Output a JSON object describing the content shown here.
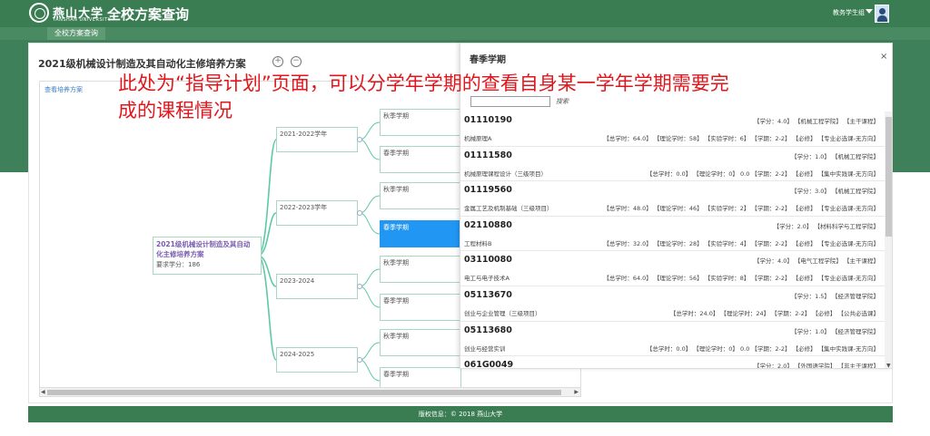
{
  "header": {
    "logo_text": "燕山大学",
    "logo_subtext": "YANSHAN UNIVERSITY",
    "app_title": "全校方案查询",
    "user_menu_label": "教务学生组"
  },
  "nav": {
    "tab_label": "全校方案查询"
  },
  "plan": {
    "title": "2021级机械设计制造及其自动化主修培养方案",
    "zoom_in_label": "+",
    "zoom_out_label": "−",
    "view_link": "查看培养方案",
    "root_title_line1": "2021级机械设计制造及其自动",
    "root_title_line2": "化主修培养方案",
    "root_credits": "要求学分：186",
    "years": [
      {
        "label": "2021-2022学年",
        "terms": [
          "秋季学期",
          "春季学期"
        ]
      },
      {
        "label": "2022-2023学年",
        "terms": [
          "秋季学期",
          "春季学期"
        ]
      },
      {
        "label": "2023-2024",
        "terms": [
          "秋季学期",
          "春季学期"
        ]
      },
      {
        "label": "2024-2025",
        "terms": [
          "秋季学期",
          "春季学期"
        ]
      }
    ]
  },
  "annotation": {
    "line1": "此处为“指导计划”页面，可以分学年学期的查看自身某一学年学期需要完",
    "line2": "成的课程情况"
  },
  "term_panel": {
    "title": "春季学期",
    "close_label": "×",
    "search_label": "搜索",
    "courses": [
      {
        "code": "01110190",
        "tags": "【学分：4.0】 【机械工程学院】 【主干课程】",
        "name": "机械原理A",
        "detail": "【总学时：64.0】 【理论学时：58】 【实验学时：6】 【学期：2-2】 【必修】 【专业必选课-无方向】"
      },
      {
        "code": "01111580",
        "tags": "【学分：1.0】 【机械工程学院】",
        "name": "机械原理课程设计（三级项目）",
        "detail": "【总学时：0.0】 【理论学时：0】 0.0 【学期：2-2】 【必修】 【集中实践课-无方向】"
      },
      {
        "code": "01119560",
        "tags": "【学分：3.0】 【机械工程学院】",
        "name": "金属工艺及机制基础（三级项目）",
        "detail": "【总学时：48.0】 【理论学时：46】 【实验学时：2】 【学期：2-2】 【必修】 【专业必选课-无方向】"
      },
      {
        "code": "02110880",
        "tags": "【学分：2.0】 【材料科学与工程学院】",
        "name": "工程材料B",
        "detail": "【总学时：32.0】 【理论学时：28】 【实验学时：4】 【学期：2-2】 【必修】 【专业必选课-无方向】"
      },
      {
        "code": "03110080",
        "tags": "【学分：4.0】 【电气工程学院】 【主干课程】",
        "name": "电工与电子技术A",
        "detail": "【总学时：64.0】 【理论学时：56】 【实验学时：8】 【学期：2-2】 【必修】 【专业必选课-无方向】"
      },
      {
        "code": "05113670",
        "tags": "【学分：1.5】 【经济管理学院】",
        "name": "创业与企业管理（三级项目）",
        "detail": "【总学时：24.0】 【理论学时：24】 【学期：2-2】 【必修】 【公共必选课】"
      },
      {
        "code": "05113680",
        "tags": "【学分：1.0】 【经济管理学院】",
        "name": "创业与经营实训",
        "detail": "【总学时：0.0】 【理论学时：0】 0.0 【学期：2-2】 【必修】 【集中实践课-无方向】"
      },
      {
        "code": "061G0049",
        "tags": "【学分：2.0】 【外国语学院】 【非主干课程】",
        "name": "",
        "detail": ""
      }
    ]
  },
  "footer": {
    "copyright": "版权信息：© 2018 燕山大学"
  },
  "colors": {
    "brand_green": "#3b7d53",
    "active_term_blue": "#2196f3",
    "annotation_red": "#e0161c",
    "branch_line": "#5fc9a3"
  }
}
